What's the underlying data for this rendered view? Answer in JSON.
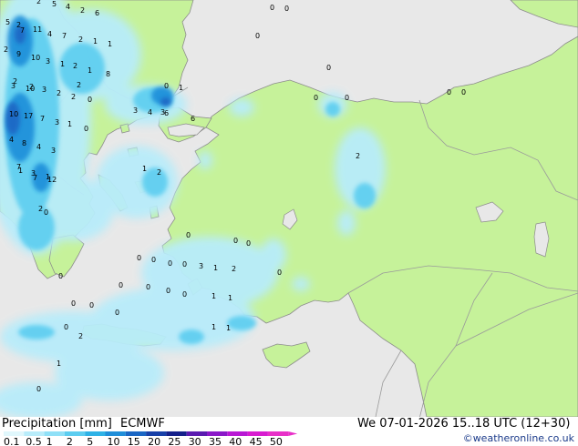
{
  "map": {
    "colors": {
      "sea": "#e8e8e8",
      "land": "#c6f29a",
      "border": "#9a9a9a",
      "coast": "#8c8c8c"
    },
    "precip_values": [
      {
        "v": "2"
      },
      {
        "v": "5"
      },
      {
        "v": "4"
      },
      {
        "v": "2"
      },
      {
        "v": "6"
      },
      {
        "v": "5"
      },
      {
        "v": "2"
      },
      {
        "v": "7"
      },
      {
        "v": "11"
      },
      {
        "v": "4"
      },
      {
        "v": "7"
      },
      {
        "v": "2"
      },
      {
        "v": "1"
      },
      {
        "v": "1"
      },
      {
        "v": "2"
      },
      {
        "v": "9"
      },
      {
        "v": "10"
      },
      {
        "v": "3"
      },
      {
        "v": "1"
      },
      {
        "v": "2"
      },
      {
        "v": "1"
      },
      {
        "v": "8"
      },
      {
        "v": "2"
      },
      {
        "v": "2"
      },
      {
        "v": "3"
      },
      {
        "v": "2"
      },
      {
        "v": "10"
      },
      {
        "v": "3"
      },
      {
        "v": "2"
      },
      {
        "v": "2"
      },
      {
        "v": "0"
      },
      {
        "v": "10"
      },
      {
        "v": "17"
      },
      {
        "v": "7"
      },
      {
        "v": "3"
      },
      {
        "v": "1"
      },
      {
        "v": "4"
      },
      {
        "v": "8"
      },
      {
        "v": "4"
      },
      {
        "v": "3"
      },
      {
        "v": "7"
      },
      {
        "v": "1"
      },
      {
        "v": "3"
      },
      {
        "v": "1"
      },
      {
        "v": "7"
      },
      {
        "v": "12"
      },
      {
        "v": "3"
      },
      {
        "v": "0"
      },
      {
        "v": "6"
      },
      {
        "v": "1"
      },
      {
        "v": "4"
      },
      {
        "v": "3"
      },
      {
        "v": "2"
      },
      {
        "v": "6"
      },
      {
        "v": "0"
      },
      {
        "v": "0"
      },
      {
        "v": "0"
      },
      {
        "v": "0"
      },
      {
        "v": "0"
      },
      {
        "v": "0"
      },
      {
        "v": "0"
      },
      {
        "v": "0"
      },
      {
        "v": "0"
      },
      {
        "v": "2"
      },
      {
        "v": "1"
      },
      {
        "v": "2"
      },
      {
        "v": "0"
      },
      {
        "v": "0"
      },
      {
        "v": "0"
      },
      {
        "v": "0"
      },
      {
        "v": "0"
      },
      {
        "v": "0"
      },
      {
        "v": "0"
      },
      {
        "v": "3"
      },
      {
        "v": "1"
      },
      {
        "v": "2"
      },
      {
        "v": "0"
      },
      {
        "v": "0"
      },
      {
        "v": "0"
      },
      {
        "v": "0"
      },
      {
        "v": "0"
      },
      {
        "v": "2"
      },
      {
        "v": "0"
      },
      {
        "v": "0"
      },
      {
        "v": "1"
      },
      {
        "v": "0"
      },
      {
        "v": "0"
      },
      {
        "v": "1"
      },
      {
        "v": "1"
      },
      {
        "v": "1"
      },
      {
        "v": "0"
      },
      {
        "v": "0"
      },
      {
        "v": "1"
      },
      {
        "v": "0"
      }
    ]
  },
  "legend": {
    "label": "Precipitation [mm]",
    "model": "ECMWF",
    "scale": [
      {
        "label": "0.1",
        "color": "#e0f7fc"
      },
      {
        "label": "0.5",
        "color": "#b8ecfa"
      },
      {
        "label": "1",
        "color": "#8fe0f7"
      },
      {
        "label": "2",
        "color": "#5ccdf0"
      },
      {
        "label": "5",
        "color": "#2eb2e6"
      },
      {
        "label": "10",
        "color": "#1f8ed9"
      },
      {
        "label": "15",
        "color": "#1a66c4"
      },
      {
        "label": "20",
        "color": "#1740a8"
      },
      {
        "label": "25",
        "color": "#14208a"
      },
      {
        "label": "30",
        "color": "#5a1ab0"
      },
      {
        "label": "35",
        "color": "#8a18c8"
      },
      {
        "label": "40",
        "color": "#b818d4"
      },
      {
        "label": "45",
        "color": "#d81cd0"
      },
      {
        "label": "50",
        "color": "#e830c8"
      }
    ]
  },
  "run_info": "We 07-01-2026 15..18 UTC (12+30)",
  "credit": "©weatheronline.co.uk"
}
